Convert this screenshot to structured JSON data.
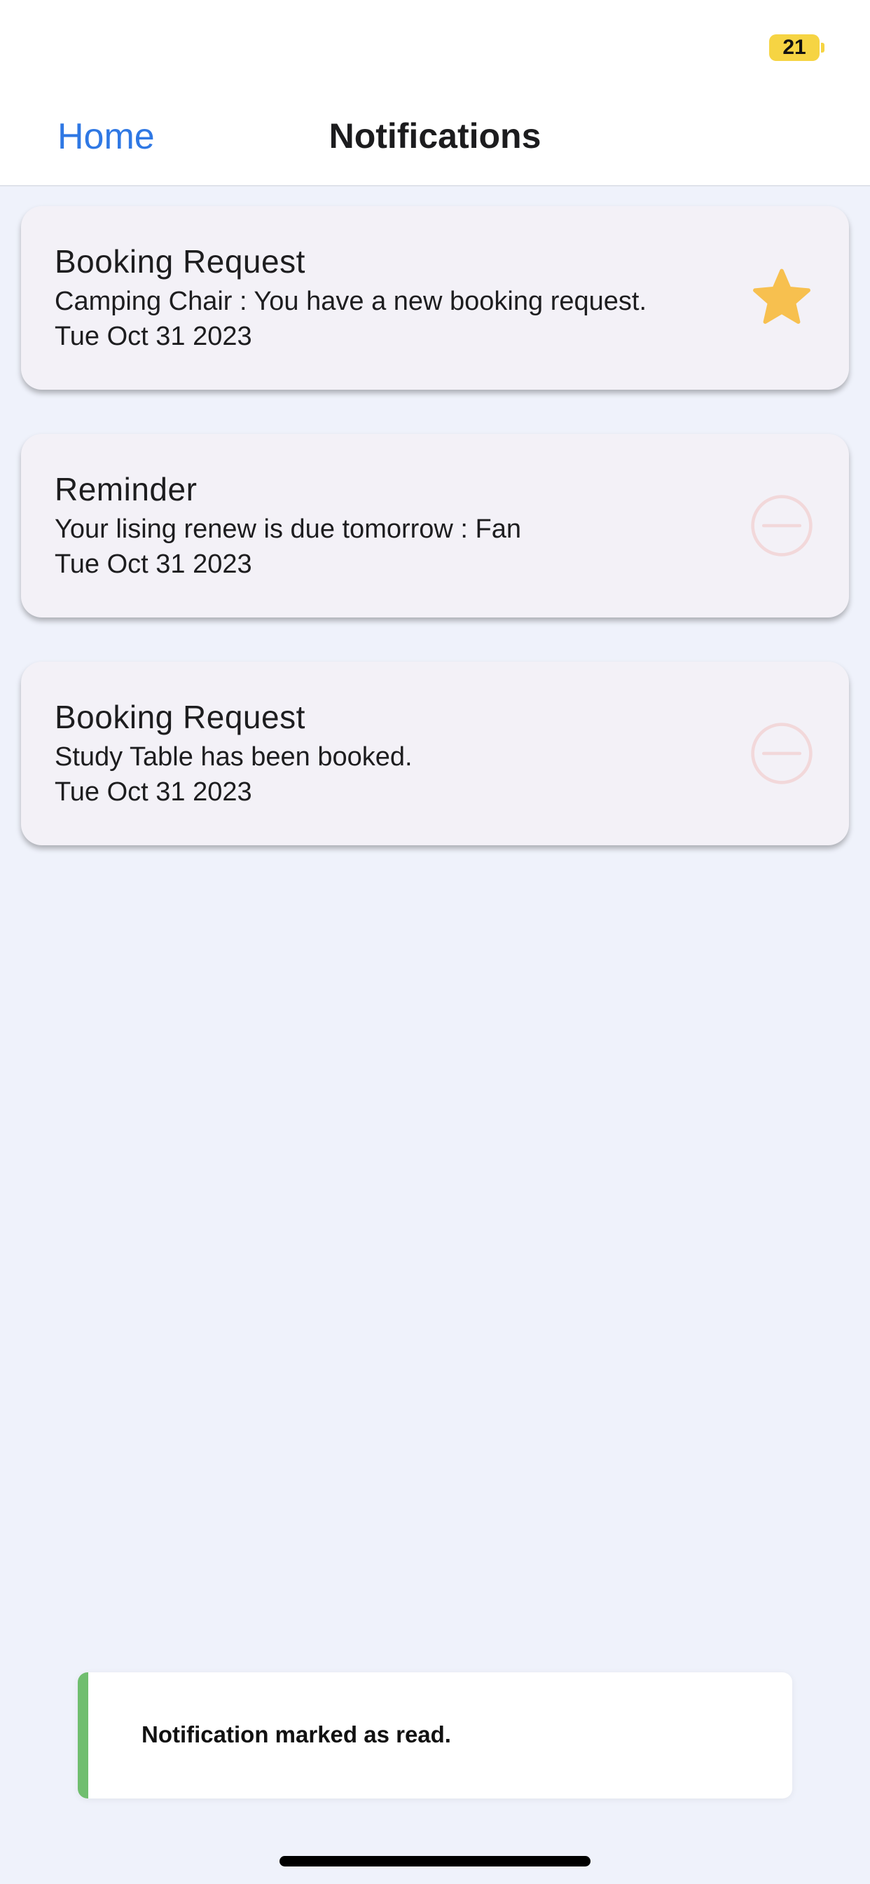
{
  "status_bar": {
    "battery_level": "21",
    "battery_color": "#f6d443"
  },
  "nav": {
    "back_label": "Home",
    "title": "Notifications"
  },
  "notifications": [
    {
      "title": "Booking Request",
      "message": "Camping Chair : You have a new booking request.",
      "date": "Tue Oct 31 2023",
      "icon": "star-icon",
      "icon_color": "#f7c04f"
    },
    {
      "title": "Reminder",
      "message": "Your lising renew is due tomorrow : Fan",
      "date": "Tue Oct 31 2023",
      "icon": "minus-circle-icon",
      "icon_color": "#f2d8da"
    },
    {
      "title": "Booking Request",
      "message": "Study Table has been booked.",
      "date": "Tue Oct 31 2023",
      "icon": "minus-circle-icon",
      "icon_color": "#f2d8da"
    }
  ],
  "toast": {
    "message": "Notification marked as read.",
    "accent_color": "#70be6f"
  },
  "colors": {
    "background": "#eff2fb",
    "link": "#2f78e4",
    "card": "#f3f1f7"
  }
}
